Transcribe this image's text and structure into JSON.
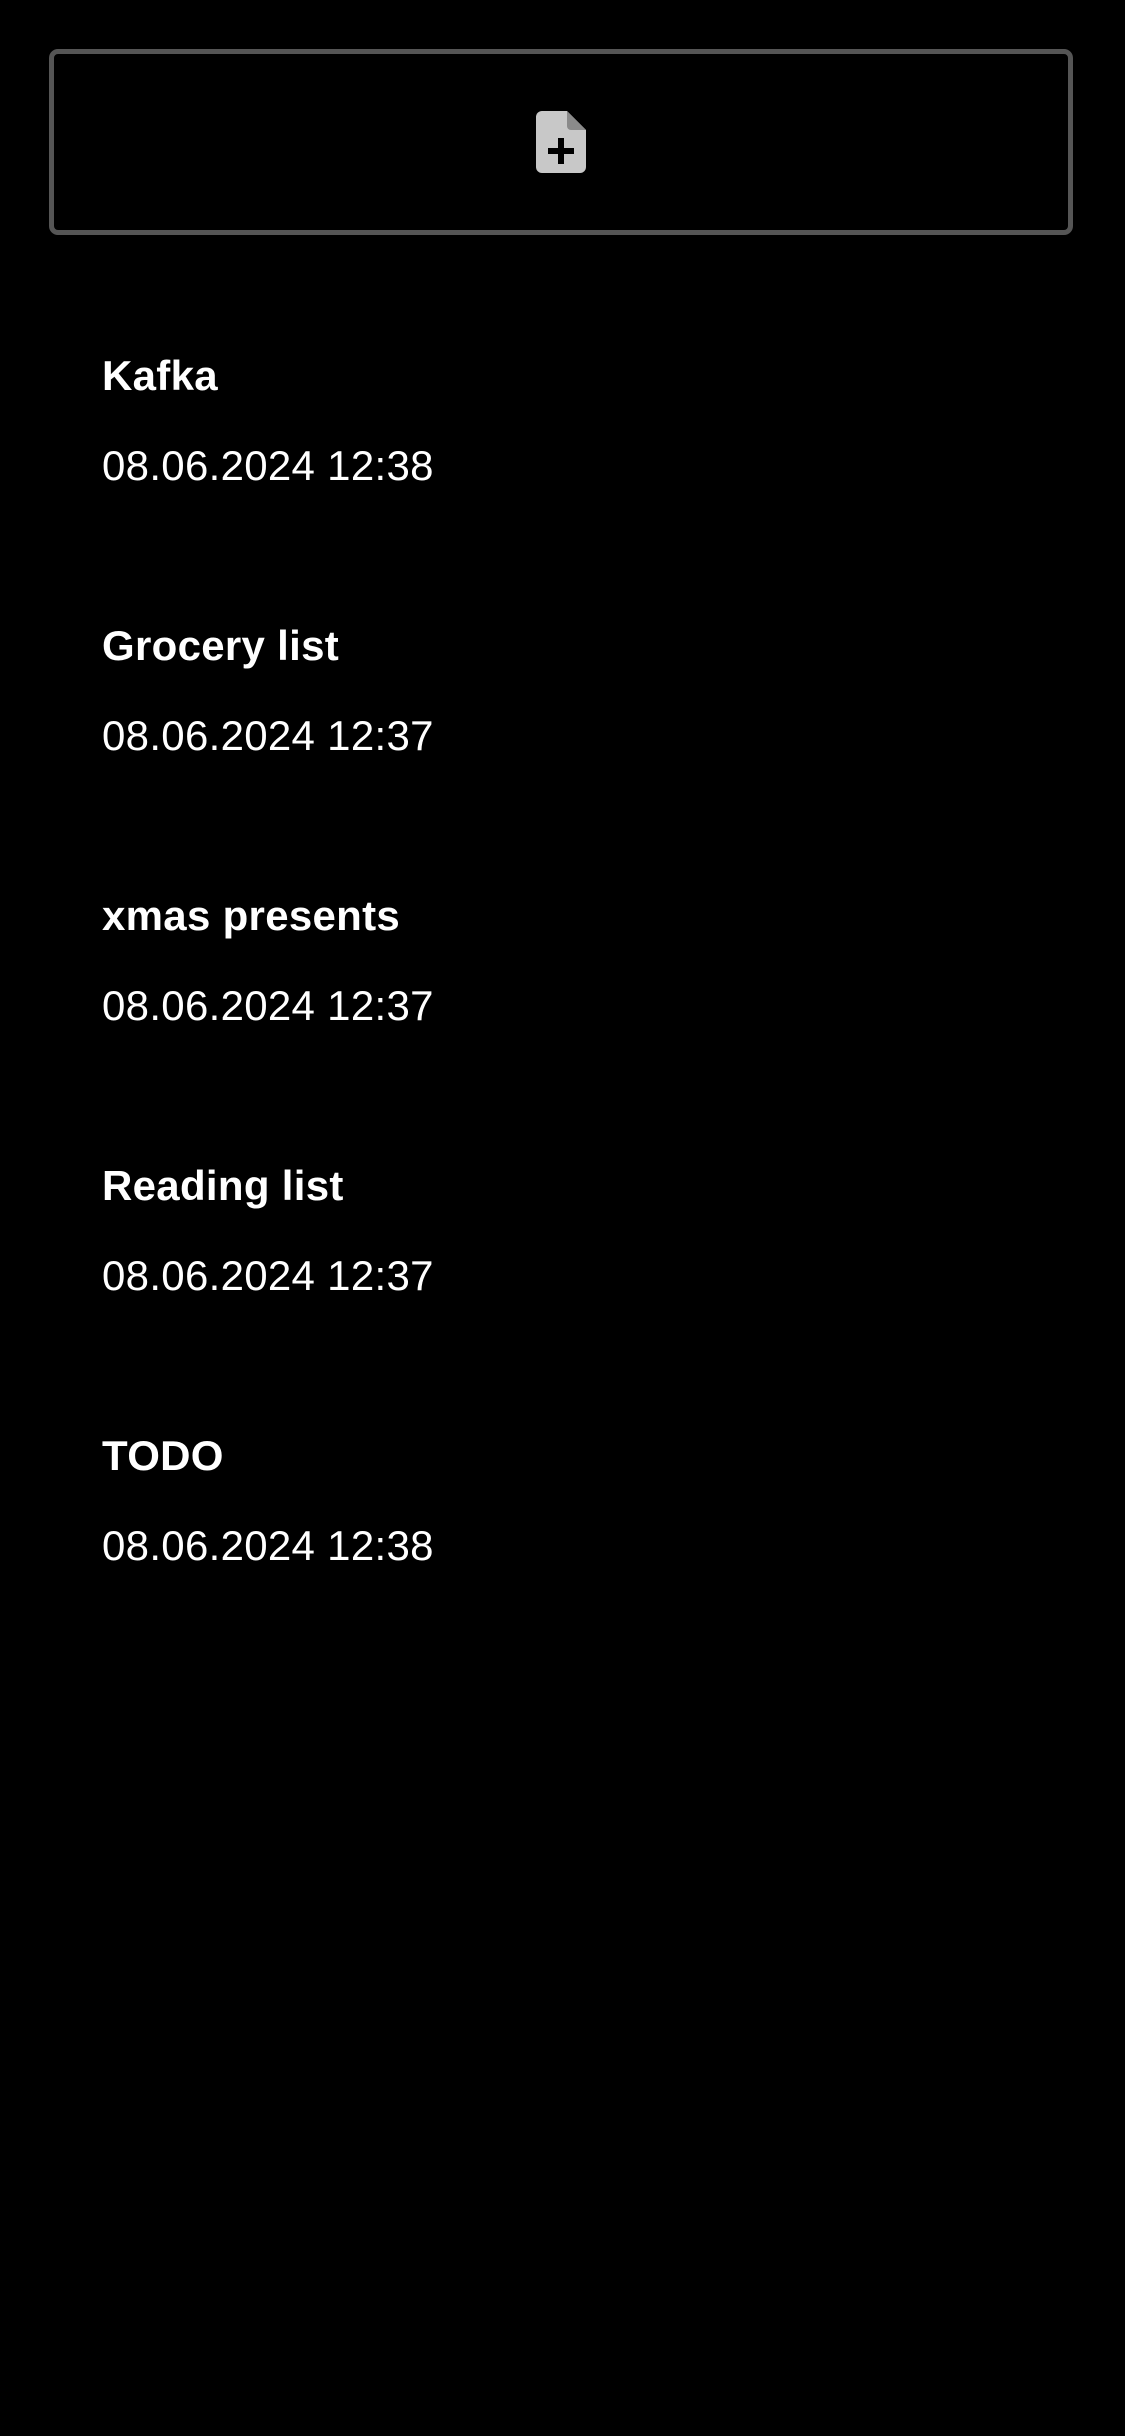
{
  "new_note_button": {
    "icon": "file-plus-icon",
    "icon_color": "#c8c8c8",
    "border_color": "#555555"
  },
  "notes": [
    {
      "title": "Kafka",
      "date": "08.06.2024 12:38"
    },
    {
      "title": "Grocery list",
      "date": "08.06.2024 12:37"
    },
    {
      "title": "xmas presents",
      "date": "08.06.2024 12:37"
    },
    {
      "title": "Reading list",
      "date": "08.06.2024 12:37"
    },
    {
      "title": "TODO",
      "date": "08.06.2024 12:38"
    }
  ],
  "colors": {
    "background": "#000000",
    "text": "#ffffff"
  }
}
